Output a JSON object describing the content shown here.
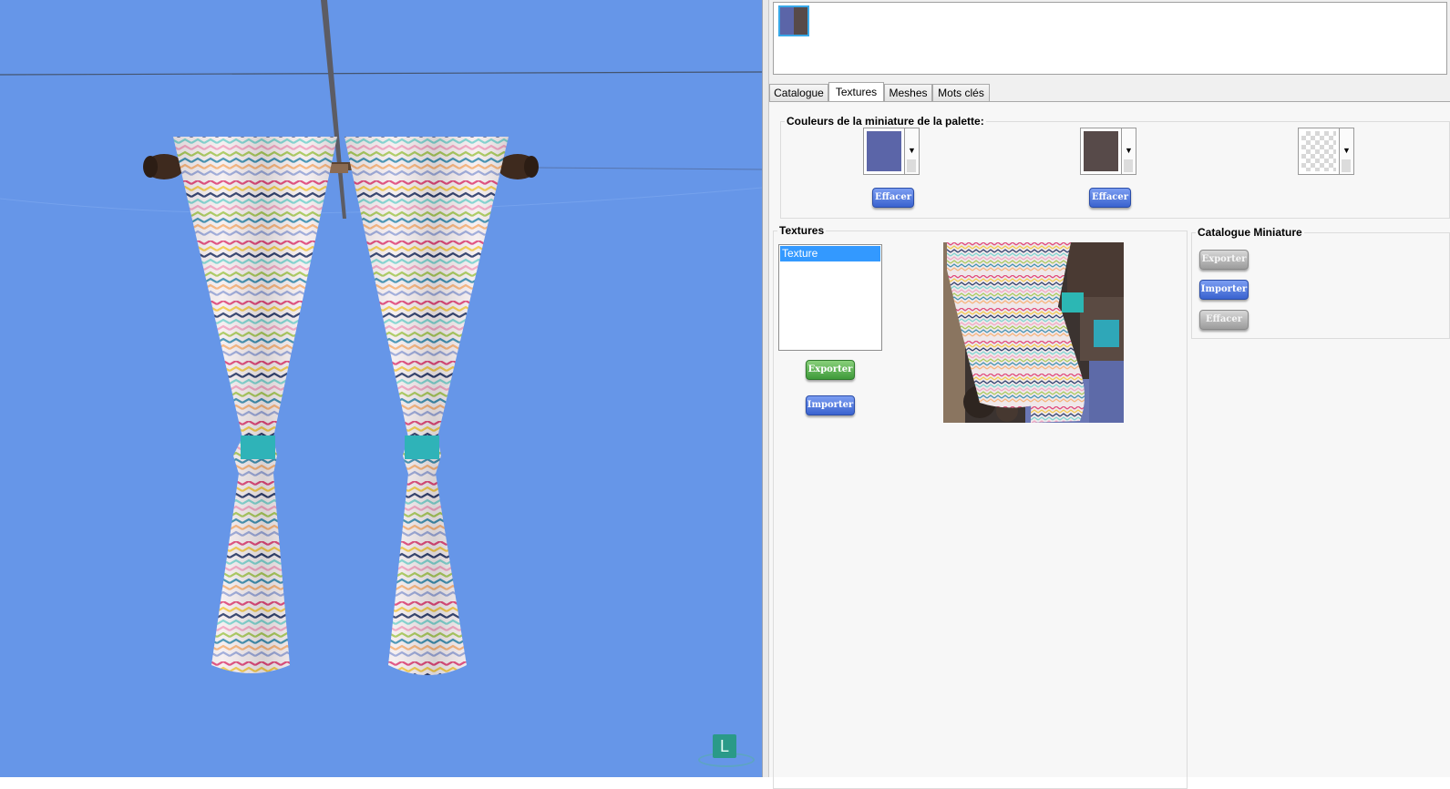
{
  "viewport": {
    "background_color": "#6696e8",
    "object": "curtain-pair",
    "indicator_label": "L"
  },
  "swatches": {
    "thumbnail_colors": [
      "#5b65a8",
      "#574a49"
    ]
  },
  "tabs": [
    {
      "label": "Catalogue",
      "active": false
    },
    {
      "label": "Textures",
      "active": true
    },
    {
      "label": "Meshes",
      "active": false
    },
    {
      "label": "Mots clés",
      "active": false
    }
  ],
  "palette": {
    "legend": "Couleurs de la miniature de la palette:",
    "colors": [
      {
        "value": "#5b65a8",
        "clear_label": "Effacer"
      },
      {
        "value": "#574a49",
        "clear_label": "Effacer"
      },
      {
        "value": "transparent",
        "clear_label": null
      }
    ]
  },
  "textures": {
    "legend": "Textures",
    "items": [
      "Texture"
    ],
    "selected": "Texture",
    "export_label": "Exporter",
    "import_label": "Importer"
  },
  "catalogue_thumbnail": {
    "legend": "Catalogue Miniature",
    "export_label": "Exporter",
    "import_label": "Importer",
    "clear_label": "Effacer"
  }
}
